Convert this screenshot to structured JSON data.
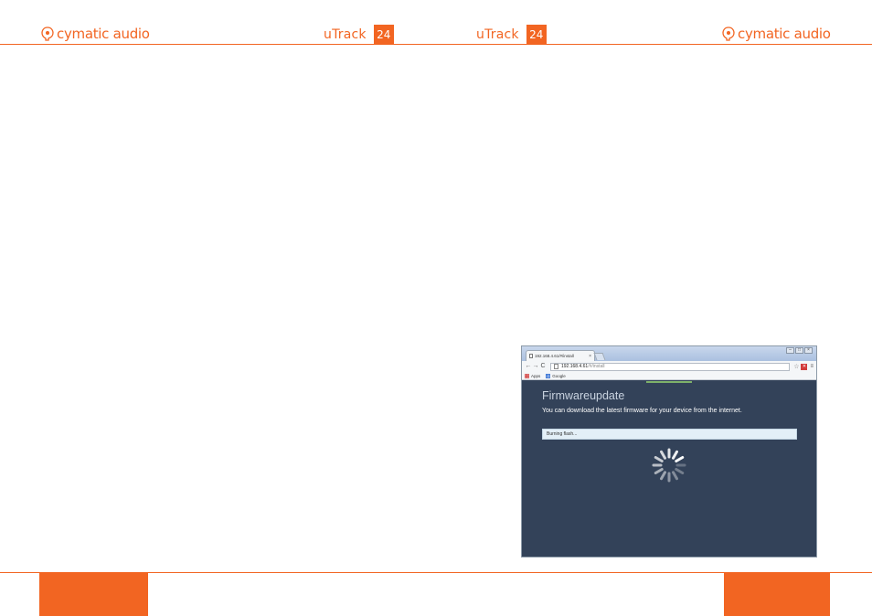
{
  "header": {
    "brand_left": "cymatic audio",
    "product_left": "uTrack",
    "product_badge_left": "24",
    "product_right": "uTrack",
    "product_badge_right": "24",
    "brand_right": "cymatic audio"
  },
  "browser": {
    "tab_title": "192.168.4.61/#/install",
    "tab_close": "×",
    "window_controls": {
      "minimize": "–",
      "maximize": "□",
      "close": "×"
    },
    "nav": {
      "back": "←",
      "forward": "→",
      "reload": "C"
    },
    "url_host": "192.168.4.61",
    "url_path": "/#/install",
    "bookmarks": [
      {
        "label": "Apps"
      },
      {
        "label": "Google",
        "icon_text": "G"
      }
    ],
    "menu_glyph": "≡",
    "star_glyph": "☆",
    "ext_glyph": "✕"
  },
  "firmware": {
    "title": "Firmwareupdate",
    "subtitle": "You can download the latest firmware for your device from the internet.",
    "status": "Burning flash..."
  },
  "colors": {
    "accent": "#f26522",
    "page_background": "#334259",
    "status_box": "#e3eff7"
  }
}
